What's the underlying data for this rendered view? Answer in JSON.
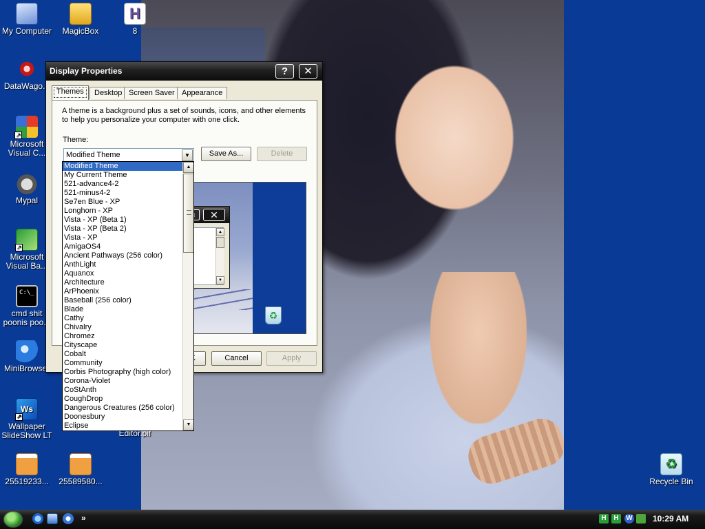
{
  "desktop": {
    "icons": [
      {
        "label": "My Computer",
        "icon": "computer-icon"
      },
      {
        "label": "MagicBox",
        "icon": "folder-icon"
      },
      {
        "label": "8",
        "icon": "h-document-icon"
      },
      {
        "label": "DataWago...",
        "icon": "network-icon"
      },
      {
        "label": "Microsoft Visual C...",
        "line1": "Microsoft",
        "line2": "Visual C...",
        "icon": "visual-studio-icon"
      },
      {
        "label": "Mypal",
        "icon": "raccoon-browser-icon"
      },
      {
        "label": "Microsoft Visual Ba...",
        "line1": "Microsoft",
        "line2": "Visual Ba...",
        "icon": "visual-basic-icon"
      },
      {
        "label": "cmd shit poonis poo...",
        "line1": "cmd shit",
        "line2": "poonis poo...",
        "icon": "command-prompt-icon"
      },
      {
        "label": "MiniBrowser",
        "icon": "minibrowser-icon"
      },
      {
        "label": "Wallpaper SlideShow LT",
        "line1": "Wallpaper",
        "line2": "SlideShow LT",
        "icon": "wallpaper-slideshow-icon"
      },
      {
        "label": "Editor.pif",
        "icon": "editor-pif-icon"
      },
      {
        "label": "25519233...",
        "icon": "image-file-icon"
      },
      {
        "label": "25589580...",
        "icon": "image-file-icon"
      },
      {
        "label": "Recycle Bin",
        "icon": "recycle-bin-icon"
      }
    ],
    "cmd_icon_text": "C:\\_"
  },
  "window": {
    "title": "Display Properties",
    "help_glyph": "?",
    "close_glyph": "✕",
    "tabs": [
      "Themes",
      "Desktop",
      "Screen Saver",
      "Appearance"
    ],
    "active_tab": "Themes",
    "intro_text": "A theme is a background plus a set of sounds, icons, and other elements to help you personalize your computer with one click.",
    "theme_label": "Theme:",
    "theme_value": "Modified Theme",
    "save_as_label": "Save As...",
    "delete_label": "Delete",
    "ok_label": "OK",
    "cancel_label": "Cancel",
    "apply_label": "Apply"
  },
  "dropdown": {
    "selected_index": 0,
    "items": [
      "Modified Theme",
      "My Current Theme",
      "521-advance4-2",
      "521-minus4-2",
      "Se7en Blue - XP",
      "Longhorn - XP",
      "Vista - XP (Beta 1)",
      "Vista - XP (Beta 2)",
      "Vista - XP",
      "AmigaOS4",
      "Ancient Pathways (256 color)",
      "AnthLight",
      "Aquanox",
      "Architecture",
      "ArPhoenix",
      "Baseball (256 color)",
      "Blade",
      "Cathy",
      "Chivalry",
      "Chromez",
      "Cityscape",
      "Cobalt",
      "Community",
      "Corbis Photography (high color)",
      "Corona-Violet",
      "CoStAnth",
      "CoughDrop",
      "Dangerous Creatures (256 color)",
      "Doonesbury",
      "Eclipse"
    ]
  },
  "taskbar": {
    "quick_launch": [
      "internet-explorer-icon",
      "show-desktop-icon",
      "media-player-icon"
    ],
    "more_glyph": "»",
    "tray": [
      {
        "icon": "h-tray-icon",
        "text": "H"
      },
      {
        "icon": "h-tray-icon",
        "text": "H"
      },
      {
        "icon": "w-tray-icon",
        "text": "W"
      },
      {
        "icon": "network-tray-icon",
        "text": ""
      }
    ],
    "clock": "10:29 AM"
  }
}
